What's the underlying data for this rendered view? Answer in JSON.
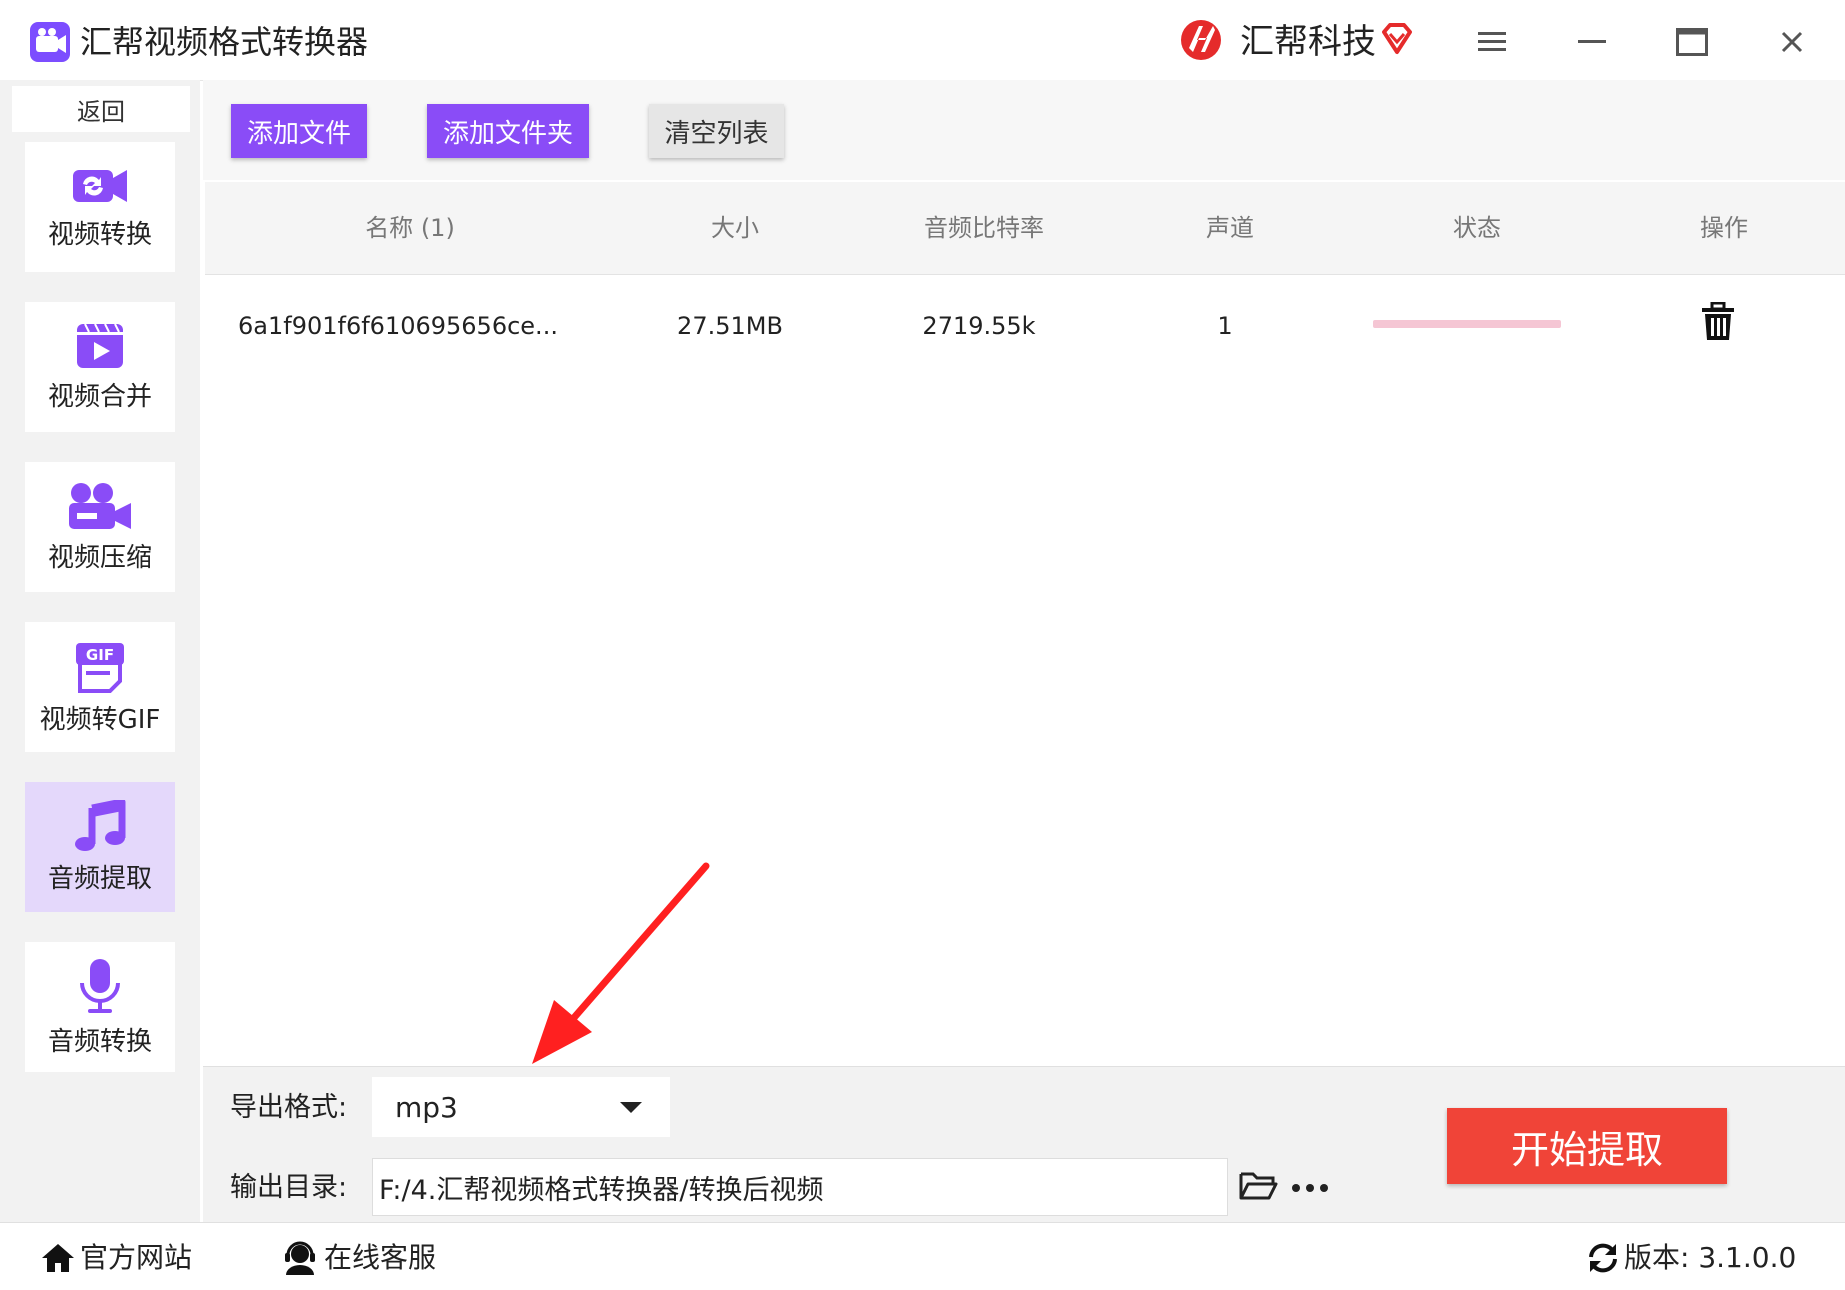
{
  "window": {
    "title": "汇帮视频格式转换器",
    "brand": "汇帮科技",
    "icons": [
      "app-icon",
      "brand-logo-icon",
      "vip-diamond-icon",
      "menu-icon",
      "minimize-icon",
      "maximize-icon",
      "close-icon"
    ]
  },
  "sidebar": {
    "back_label": "返回",
    "items": [
      {
        "label": "视频转换",
        "icon": "video-convert-icon",
        "active": false
      },
      {
        "label": "视频合并",
        "icon": "video-merge-icon",
        "active": false
      },
      {
        "label": "视频压缩",
        "icon": "video-compress-icon",
        "active": false
      },
      {
        "label": "视频转GIF",
        "icon": "gif-icon",
        "active": false
      },
      {
        "label": "音频提取",
        "icon": "music-note-icon",
        "active": true
      },
      {
        "label": "音频转换",
        "icon": "microphone-icon",
        "active": false
      }
    ]
  },
  "toolbar": {
    "add_file": "添加文件",
    "add_folder": "添加文件夹",
    "clear_list": "清空列表"
  },
  "table": {
    "headers": [
      "名称 (1)",
      "大小",
      "音频比特率",
      "声道",
      "状态",
      "操作"
    ],
    "rows": [
      {
        "name": "6a1f901f6f610695656ce...",
        "size": "27.51MB",
        "bitrate": "2719.55k",
        "channels": "1",
        "status_progress": 0,
        "action_icon": "trash-icon"
      }
    ]
  },
  "export": {
    "format_label": "导出格式:",
    "format_value": "mp3",
    "dir_label": "输出目录:",
    "dir_value": "F:/4.汇帮视频格式转换器/转换后视频",
    "start_button": "开始提取"
  },
  "footer": {
    "website": "官方网站",
    "support": "在线客服",
    "version": "版本: 3.1.0.0"
  },
  "colors": {
    "accent_purple": "#8a4cf7",
    "start_red": "#f04438",
    "active_nav_bg": "#e4d8fb",
    "progress_pink": "#f5c6d4",
    "arrow_red": "#ff2020"
  }
}
